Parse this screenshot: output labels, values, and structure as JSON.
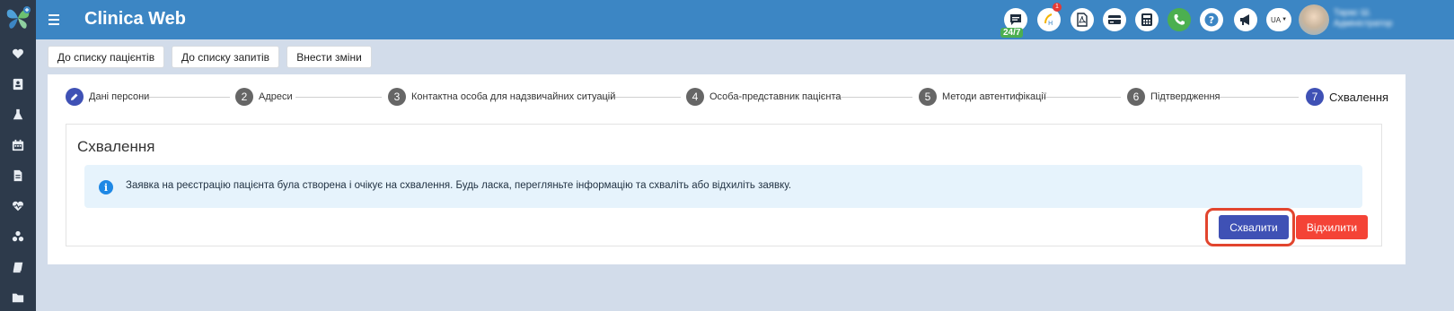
{
  "header": {
    "app_title": "Clinica Web",
    "chat_badge": "24/7",
    "notification_count": "1",
    "language": "UA",
    "user_name_line1": "Тарас Ш.",
    "user_name_line2": "Адміністратор"
  },
  "colors": {
    "header": "#3c86c4",
    "sidebar": "#2d3a4b",
    "primary": "#3f51b5",
    "danger": "#f44336",
    "info_bg": "#e6f3fc"
  },
  "sidebar": {
    "icons": [
      "heart-icon",
      "contact-card-icon",
      "flask-icon",
      "calendar-icon",
      "document-icon",
      "heartbeat-icon",
      "network-icon",
      "book-icon",
      "folder-icon"
    ]
  },
  "toolbar": {
    "to_patients": "До списку пацієнтів",
    "to_requests": "До списку запитів",
    "edit": "Внести зміни"
  },
  "stepper": {
    "steps": [
      {
        "number": "1",
        "label": "Дані персони",
        "state": "edited"
      },
      {
        "number": "2",
        "label": "Адреси",
        "state": "pending"
      },
      {
        "number": "3",
        "label": "Контактна особа для надзвичайних ситуацій",
        "state": "pending"
      },
      {
        "number": "4",
        "label": "Особа-представник пацієнта",
        "state": "pending"
      },
      {
        "number": "5",
        "label": "Методи автентифікації",
        "state": "pending"
      },
      {
        "number": "6",
        "label": "Підтвердження",
        "state": "pending"
      },
      {
        "number": "7",
        "label": "Схвалення",
        "state": "active"
      }
    ]
  },
  "card": {
    "title": "Схвалення",
    "alert_text": "Заявка на реєстрацію пацієнта була створена і очікує на схвалення. Будь ласка, перегляньте інформацію та схваліть або відхиліть заявку.",
    "approve_label": "Схвалити",
    "reject_label": "Відхилити"
  }
}
